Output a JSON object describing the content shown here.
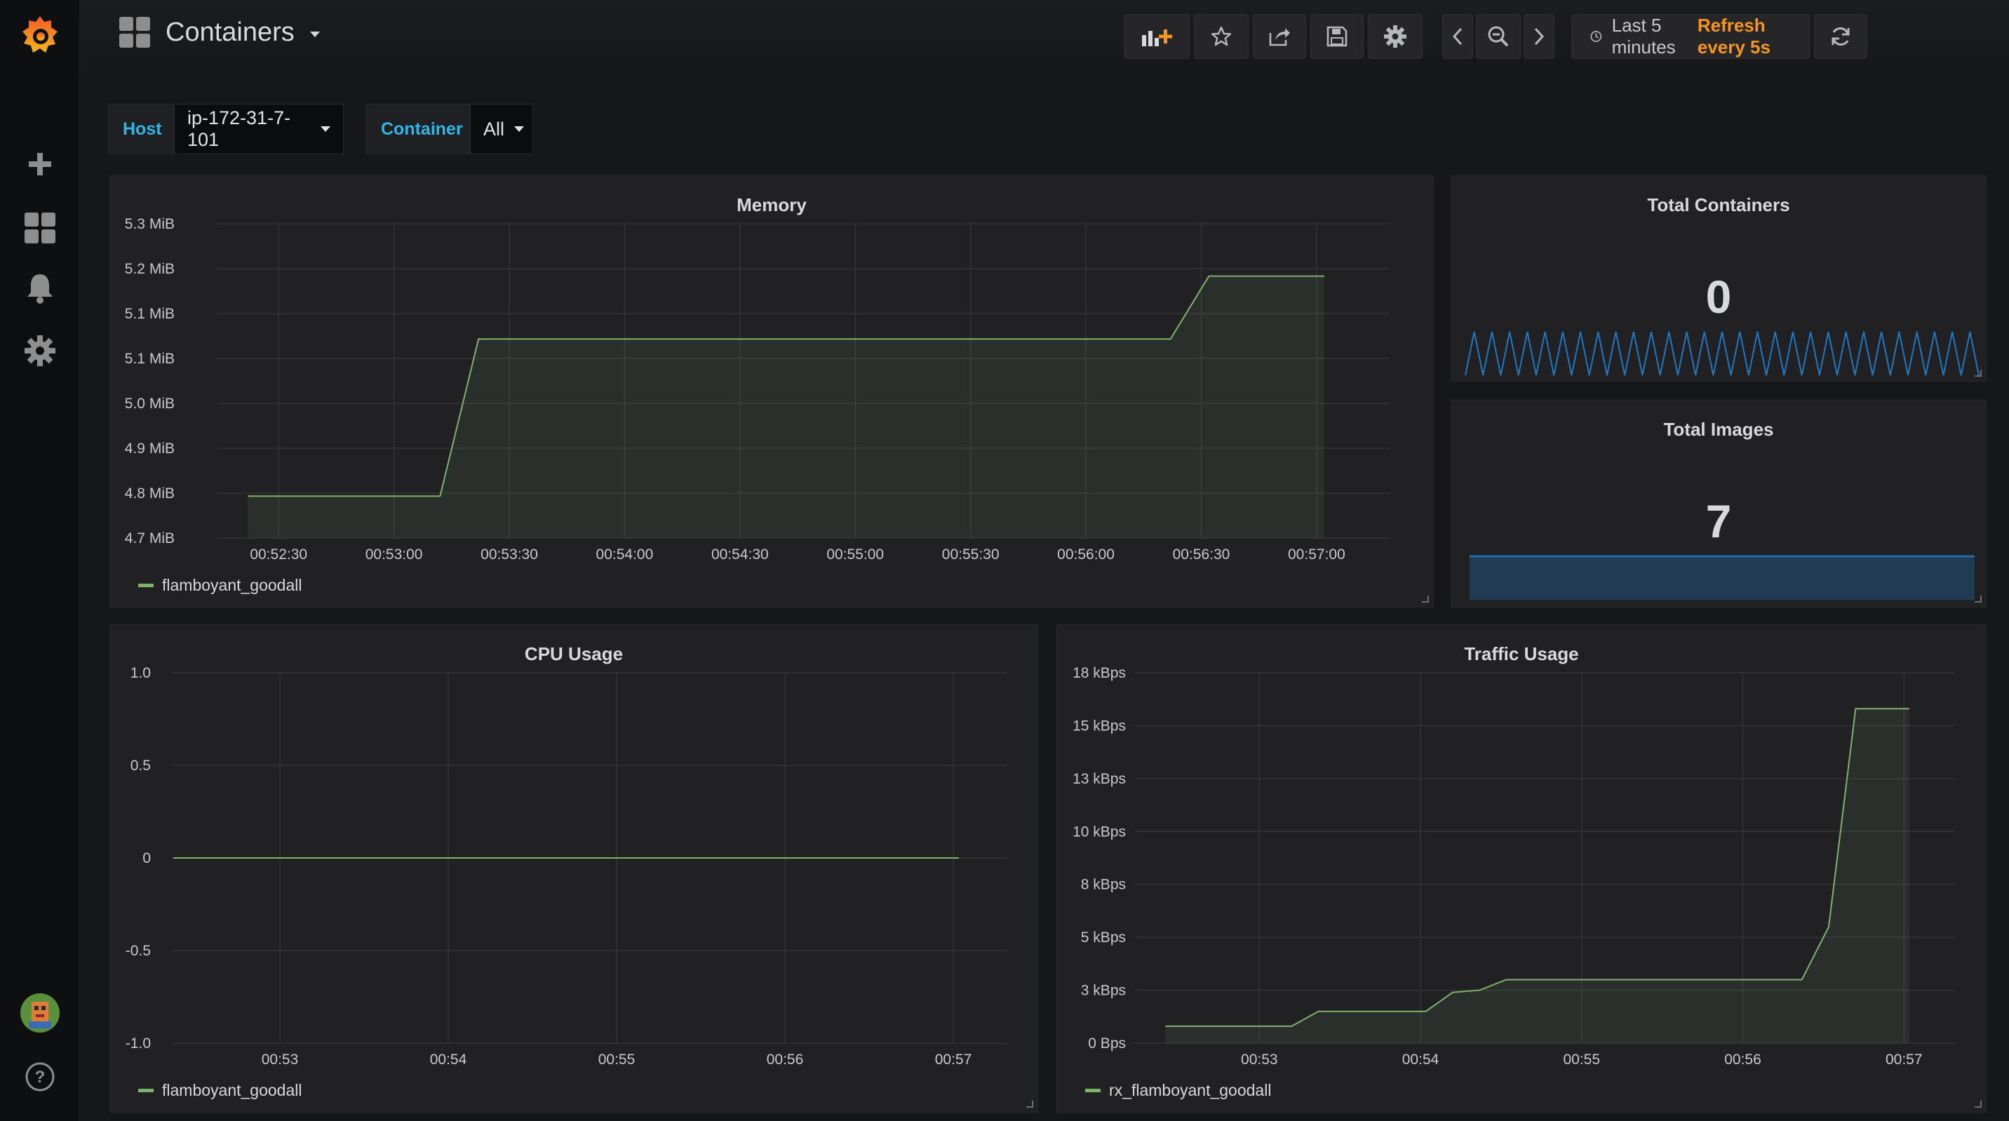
{
  "topbar": {
    "title": "Containers",
    "time_range": "Last 5 minutes",
    "refresh": "Refresh every 5s"
  },
  "variables": {
    "host_label": "Host",
    "host_value": "ip-172-31-7-101",
    "container_label": "Container",
    "container_value": "All"
  },
  "panels": {
    "memory_title": "Memory",
    "total_containers_title": "Total Containers",
    "total_containers_value": "0",
    "total_images_title": "Total Images",
    "total_images_value": "7",
    "cpu_title": "CPU Usage",
    "traffic_title": "Traffic Usage"
  },
  "colors": {
    "series": "#7eb26d",
    "sparkline": "#1f78c1",
    "accent": "#f79520",
    "variable_label": "#33b5e5"
  },
  "icons": [
    "grafana-logo-icon",
    "plus-icon",
    "dashboards-icon",
    "bell-icon",
    "gear-icon",
    "avatar",
    "help-icon",
    "add-panel-icon",
    "star-icon",
    "share-icon",
    "save-icon",
    "settings-icon",
    "chevron-left-icon",
    "zoom-out-icon",
    "chevron-right-icon",
    "clock-icon",
    "refresh-icon"
  ],
  "chart_data": [
    {
      "name": "memory",
      "type": "area",
      "x_ticks": [
        "00:52:30",
        "00:53:00",
        "00:53:30",
        "00:54:00",
        "00:54:30",
        "00:55:00",
        "00:55:30",
        "00:56:00",
        "00:56:30",
        "00:57:00"
      ],
      "y_ticks": [
        "5.3 MiB",
        "5.2 MiB",
        "5.1 MiB",
        "5.1 MiB",
        "5.0 MiB",
        "4.9 MiB",
        "4.8 MiB",
        "4.7 MiB"
      ],
      "ylim": [
        4.7,
        5.3
      ],
      "series": [
        {
          "name": "flamboyant_goodall",
          "points": [
            [
              "00:52:22",
              4.78
            ],
            [
              "00:53:12",
              4.78
            ],
            [
              "00:53:22",
              5.08
            ],
            [
              "00:56:22",
              5.08
            ],
            [
              "00:56:32",
              5.2
            ],
            [
              "00:57:02",
              5.2
            ]
          ]
        }
      ]
    },
    {
      "name": "cpu",
      "type": "line",
      "x_ticks": [
        "00:53",
        "00:54",
        "00:55",
        "00:56",
        "00:57"
      ],
      "y_ticks": [
        "1.0",
        "0.5",
        "0",
        "-0.5",
        "-1.0"
      ],
      "ylim": [
        -1.0,
        1.0
      ],
      "series": [
        {
          "name": "flamboyant_goodall",
          "points": [
            [
              "00:52:22",
              0
            ],
            [
              "00:57:02",
              0
            ]
          ]
        }
      ]
    },
    {
      "name": "traffic",
      "type": "area",
      "x_ticks": [
        "00:53",
        "00:54",
        "00:55",
        "00:56",
        "00:57"
      ],
      "y_ticks": [
        "18 kBps",
        "15 kBps",
        "13 kBps",
        "10 kBps",
        "8 kBps",
        "5 kBps",
        "3 kBps",
        "0 Bps"
      ],
      "ylim": [
        0,
        17.5
      ],
      "series": [
        {
          "name": "rx_flamboyant_goodall",
          "points": [
            [
              "00:52:25",
              0.8
            ],
            [
              "00:53:12",
              0.8
            ],
            [
              "00:53:22",
              1.5
            ],
            [
              "00:54:02",
              1.5
            ],
            [
              "00:54:12",
              2.4
            ],
            [
              "00:54:22",
              2.5
            ],
            [
              "00:54:32",
              3.0
            ],
            [
              "00:56:22",
              3.0
            ],
            [
              "00:56:32",
              5.5
            ],
            [
              "00:56:42",
              15.8
            ],
            [
              "00:57:02",
              15.8
            ]
          ]
        }
      ]
    },
    {
      "name": "total_containers_sparkline",
      "type": "line",
      "values": [
        0,
        1,
        0,
        1,
        0,
        1,
        0,
        1,
        0,
        1,
        0,
        1,
        0,
        1,
        0,
        1,
        0,
        1,
        0,
        1,
        0,
        1,
        0,
        1,
        0,
        1,
        0,
        1,
        0,
        1,
        0,
        1,
        0,
        1,
        0,
        1,
        0,
        1,
        0,
        1,
        0,
        1,
        0,
        1,
        0,
        1,
        0,
        1,
        0,
        1,
        0,
        1,
        0,
        1,
        0,
        1,
        0,
        1,
        0
      ]
    },
    {
      "name": "total_images_sparkline",
      "type": "area",
      "values": [
        7,
        7
      ]
    }
  ]
}
